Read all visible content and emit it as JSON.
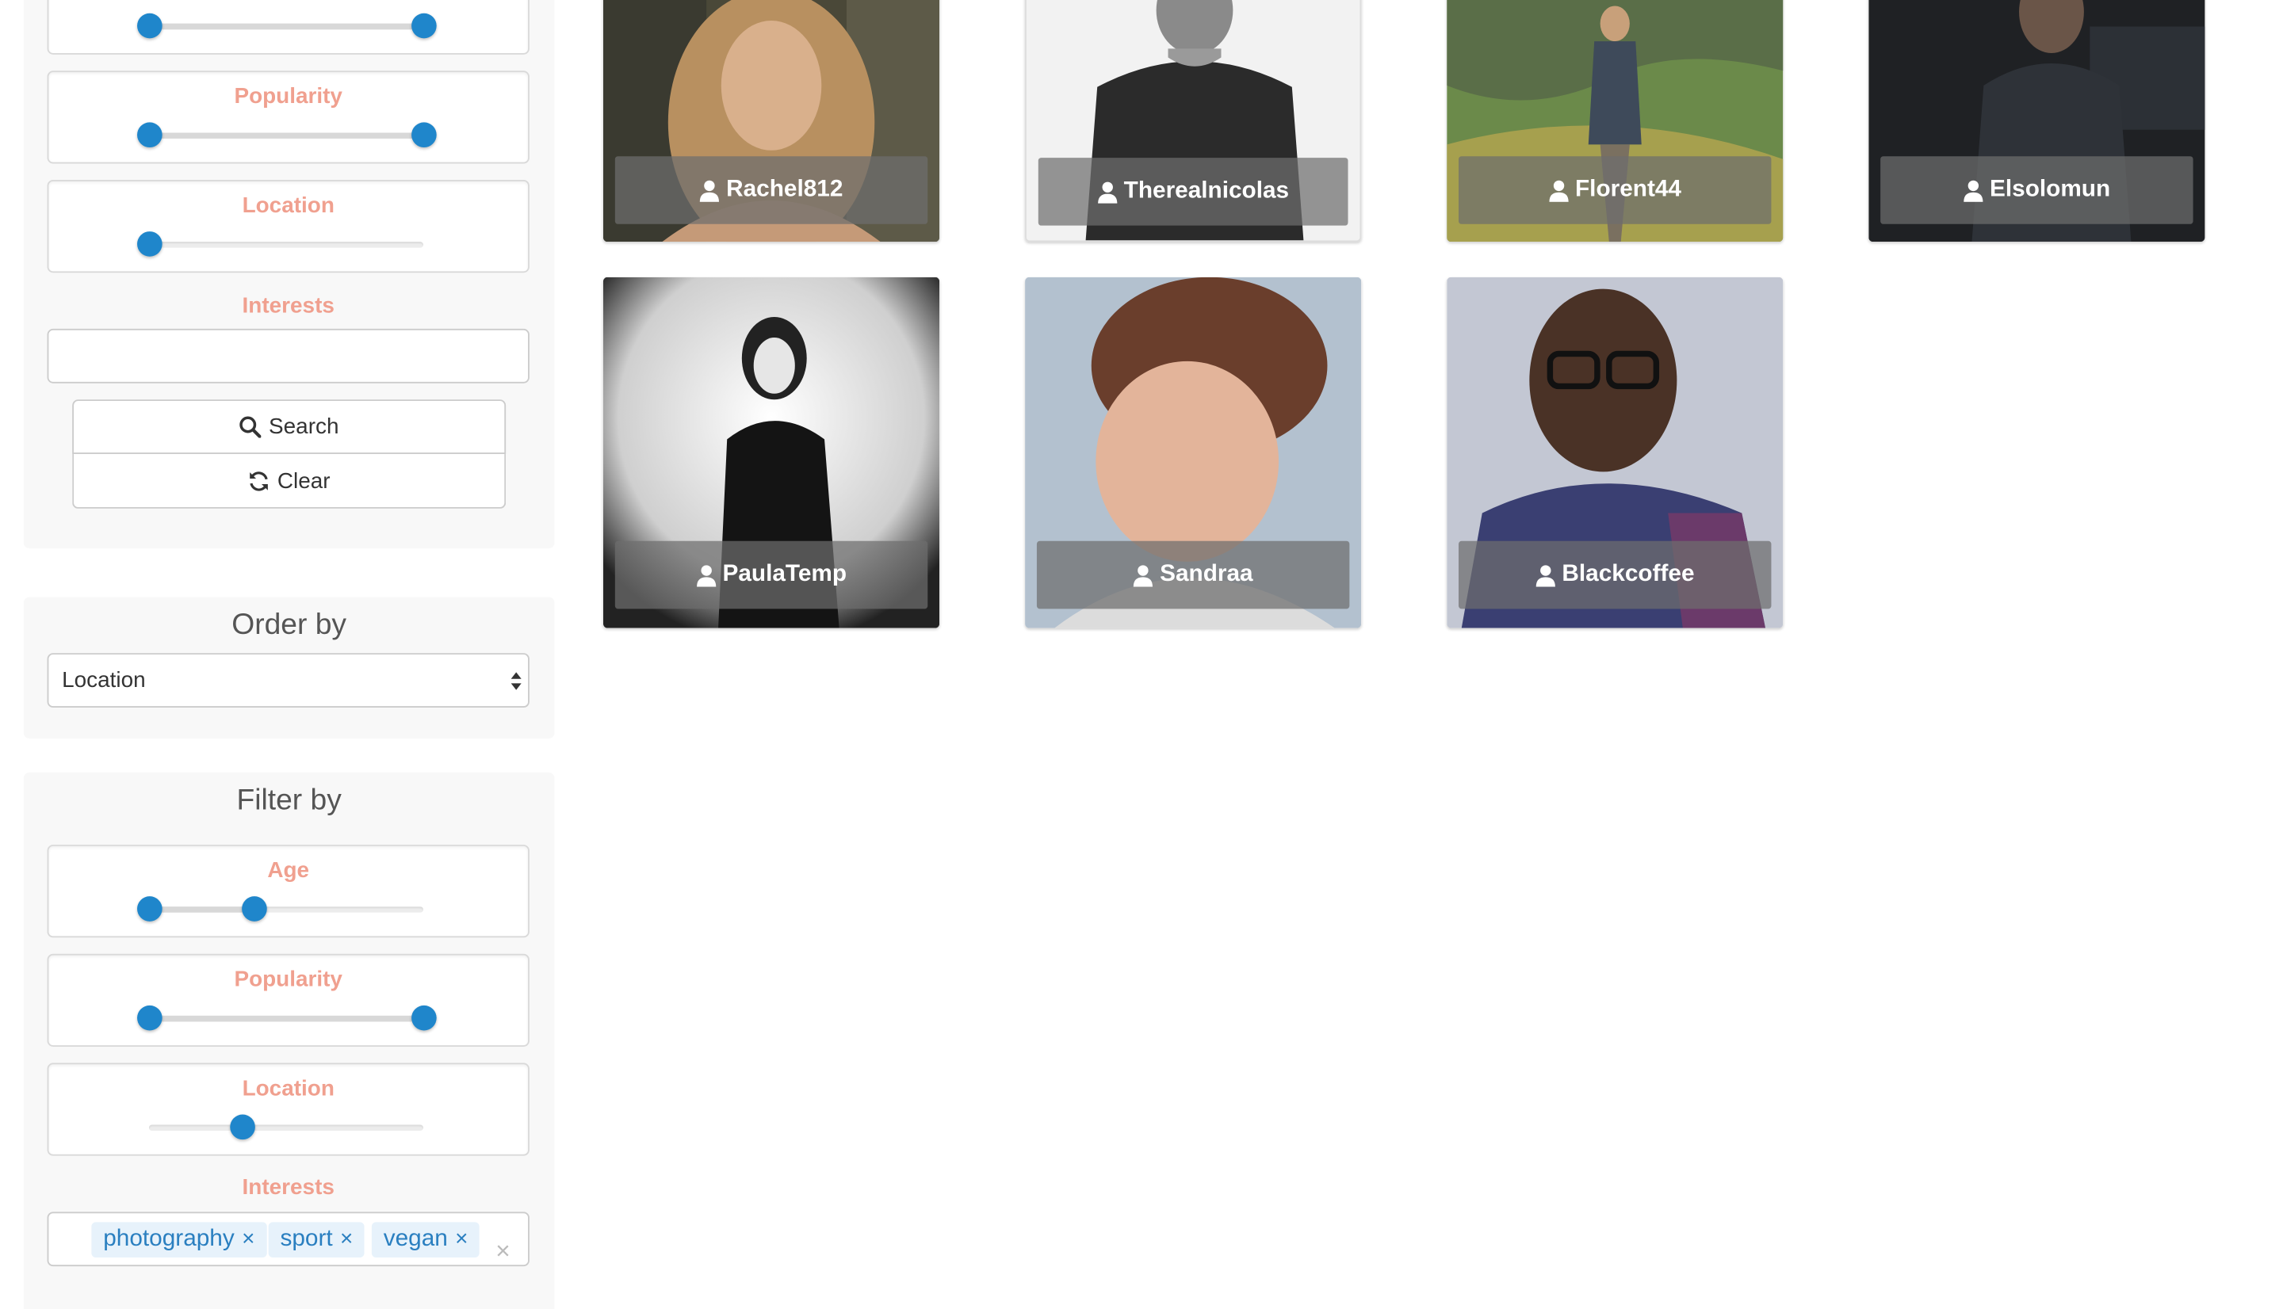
{
  "search_panel": {
    "sliders": [
      {
        "label": "",
        "low": 0,
        "high": 1
      },
      {
        "label": "Popularity",
        "low": 0,
        "high": 1
      },
      {
        "label": "Location",
        "low": 0,
        "high": null
      }
    ],
    "interests_label": "Interests",
    "interests_value": "",
    "search_button": "Search",
    "clear_button": "Clear"
  },
  "order_panel": {
    "title": "Order by",
    "selected": "Location"
  },
  "filter_panel": {
    "title": "Filter by",
    "sliders": [
      {
        "label": "Age",
        "low": 0,
        "high": 0.38
      },
      {
        "label": "Popularity",
        "low": 0,
        "high": 1
      },
      {
        "label": "Location",
        "low": null,
        "high": 0.34
      }
    ],
    "interests_label": "Interests",
    "tags": [
      "photography",
      "sport",
      "vegan"
    ],
    "tag_remove": "×",
    "clear_all": "×"
  },
  "profiles": [
    {
      "username": "Rachel812"
    },
    {
      "username": "Therealnicolas"
    },
    {
      "username": "Florent44"
    },
    {
      "username": "Elsolomun"
    },
    {
      "username": "PaulaTemp"
    },
    {
      "username": "Sandraa"
    },
    {
      "username": "Blackcoffee"
    }
  ],
  "colors": {
    "accent": "#1f86cb",
    "label": "#f0a08f",
    "tag_bg": "#e7f2fb",
    "tag_text": "#2a7fc0"
  },
  "icons": {
    "search_button": "search-icon",
    "clear_button": "refresh-icon",
    "profile": "user-icon",
    "select": "updown-arrows-icon"
  }
}
